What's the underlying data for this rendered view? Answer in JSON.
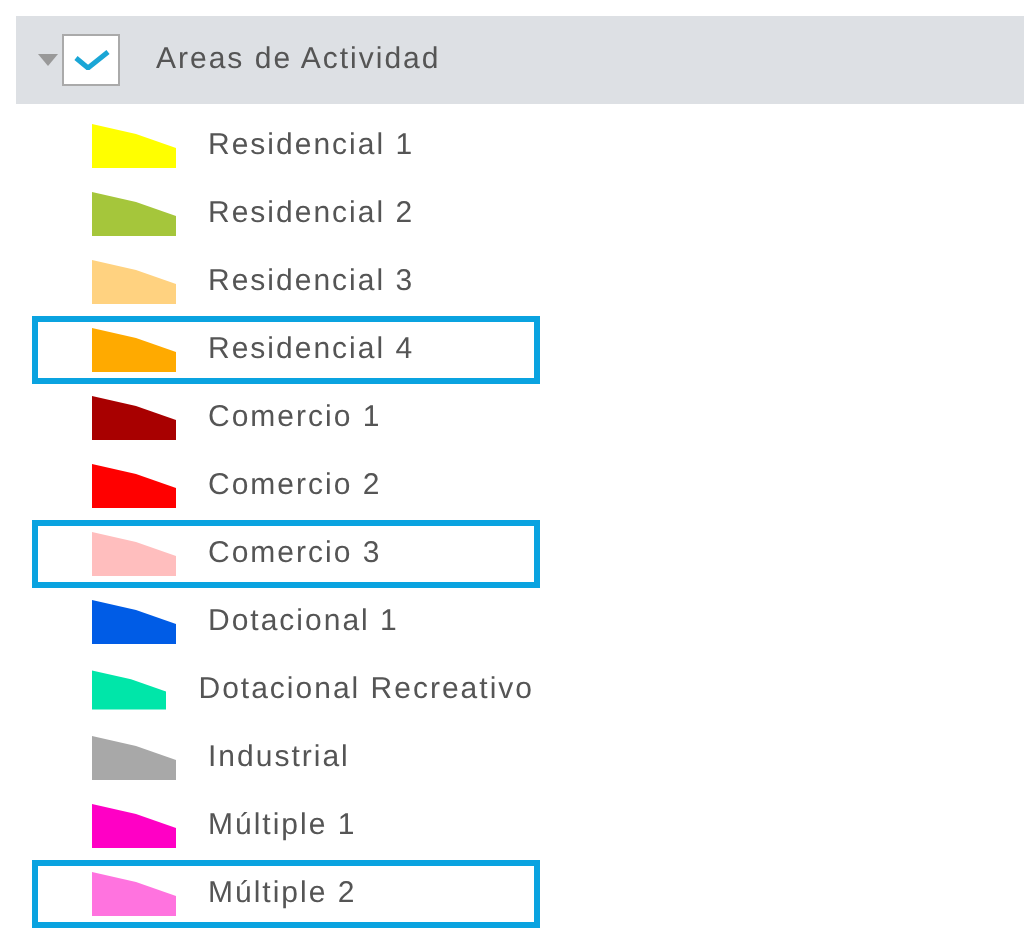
{
  "layer": {
    "title": "Areas de Actividad",
    "expanded": true,
    "checked": true
  },
  "legend": [
    {
      "label": "Residencial 1",
      "color": "#ffff00",
      "highlighted": false
    },
    {
      "label": "Residencial 2",
      "color": "#a5c63b",
      "highlighted": false
    },
    {
      "label": "Residencial 3",
      "color": "#ffd280",
      "highlighted": false
    },
    {
      "label": "Residencial 4",
      "color": "#ffaa00",
      "highlighted": true
    },
    {
      "label": "Comercio 1",
      "color": "#a80000",
      "highlighted": false
    },
    {
      "label": "Comercio 2",
      "color": "#ff0000",
      "highlighted": false
    },
    {
      "label": "Comercio 3",
      "color": "#ffbebe",
      "highlighted": true
    },
    {
      "label": "Dotacional 1",
      "color": "#005ce6",
      "highlighted": false
    },
    {
      "label": "Dotacional Recreativo",
      "color": "#00e6a9",
      "highlighted": false
    },
    {
      "label": "Industrial",
      "color": "#a8a8a8",
      "highlighted": false
    },
    {
      "label": "Múltiple 1",
      "color": "#ff00c5",
      "highlighted": false
    },
    {
      "label": "Múltiple 2",
      "color": "#ff73df",
      "highlighted": true
    }
  ]
}
